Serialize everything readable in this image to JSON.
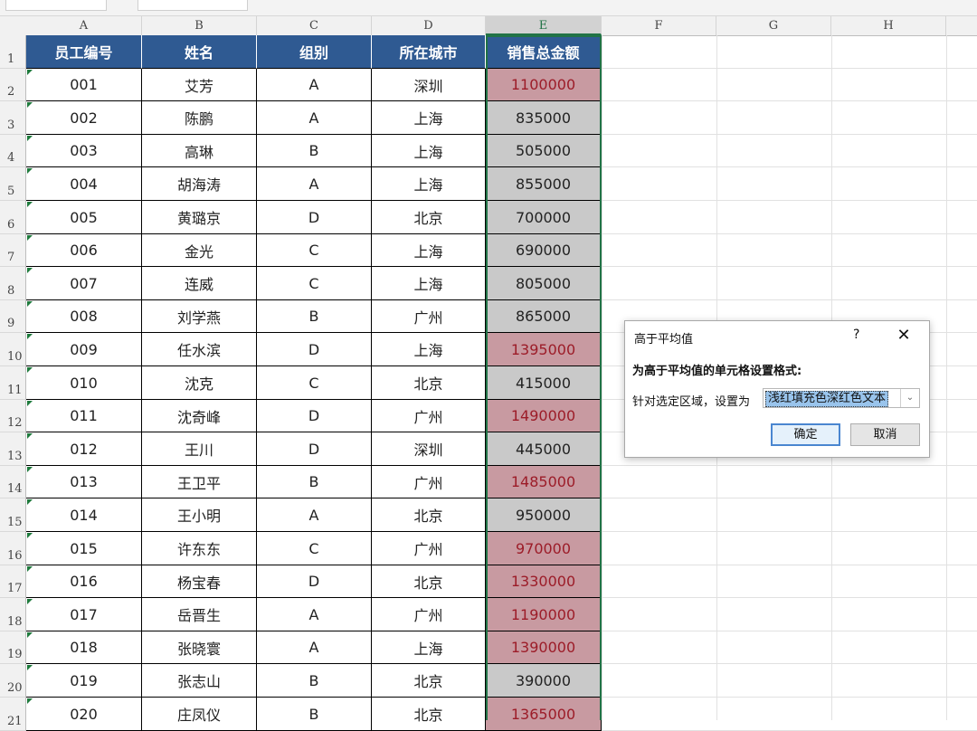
{
  "columns": [
    "A",
    "B",
    "C",
    "D",
    "E",
    "F",
    "G",
    "H"
  ],
  "headers": [
    "员工编号",
    "姓名",
    "组别",
    "所在城市",
    "销售总金额"
  ],
  "rows": [
    {
      "row": "1"
    },
    {
      "row": "2",
      "id": "001",
      "name": "艾芳",
      "group": "A",
      "city": "深圳",
      "sales": "1100000",
      "highlight": true
    },
    {
      "row": "3",
      "id": "002",
      "name": "陈鹏",
      "group": "A",
      "city": "上海",
      "sales": "835000",
      "highlight": false
    },
    {
      "row": "4",
      "id": "003",
      "name": "高琳",
      "group": "B",
      "city": "上海",
      "sales": "505000",
      "highlight": false
    },
    {
      "row": "5",
      "id": "004",
      "name": "胡海涛",
      "group": "A",
      "city": "上海",
      "sales": "855000",
      "highlight": false
    },
    {
      "row": "6",
      "id": "005",
      "name": "黄璐京",
      "group": "D",
      "city": "北京",
      "sales": "700000",
      "highlight": false
    },
    {
      "row": "7",
      "id": "006",
      "name": "金光",
      "group": "C",
      "city": "上海",
      "sales": "690000",
      "highlight": false
    },
    {
      "row": "8",
      "id": "007",
      "name": "连威",
      "group": "C",
      "city": "上海",
      "sales": "805000",
      "highlight": false
    },
    {
      "row": "9",
      "id": "008",
      "name": "刘学燕",
      "group": "B",
      "city": "广州",
      "sales": "865000",
      "highlight": false
    },
    {
      "row": "10",
      "id": "009",
      "name": "任水滨",
      "group": "D",
      "city": "上海",
      "sales": "1395000",
      "highlight": true
    },
    {
      "row": "11",
      "id": "010",
      "name": "沈克",
      "group": "C",
      "city": "北京",
      "sales": "415000",
      "highlight": false
    },
    {
      "row": "12",
      "id": "011",
      "name": "沈奇峰",
      "group": "D",
      "city": "广州",
      "sales": "1490000",
      "highlight": true
    },
    {
      "row": "13",
      "id": "012",
      "name": "王川",
      "group": "D",
      "city": "深圳",
      "sales": "445000",
      "highlight": false
    },
    {
      "row": "14",
      "id": "013",
      "name": "王卫平",
      "group": "B",
      "city": "广州",
      "sales": "1485000",
      "highlight": true
    },
    {
      "row": "15",
      "id": "014",
      "name": "王小明",
      "group": "A",
      "city": "北京",
      "sales": "950000",
      "highlight": false
    },
    {
      "row": "16",
      "id": "015",
      "name": "许东东",
      "group": "C",
      "city": "广州",
      "sales": "970000",
      "highlight": true
    },
    {
      "row": "17",
      "id": "016",
      "name": "杨宝春",
      "group": "D",
      "city": "北京",
      "sales": "1330000",
      "highlight": true
    },
    {
      "row": "18",
      "id": "017",
      "name": "岳晋生",
      "group": "A",
      "city": "广州",
      "sales": "1190000",
      "highlight": true
    },
    {
      "row": "19",
      "id": "018",
      "name": "张晓寰",
      "group": "A",
      "city": "上海",
      "sales": "1390000",
      "highlight": true
    },
    {
      "row": "20",
      "id": "019",
      "name": "张志山",
      "group": "B",
      "city": "北京",
      "sales": "390000",
      "highlight": false
    },
    {
      "row": "21",
      "id": "020",
      "name": "庄凤仪",
      "group": "B",
      "city": "北京",
      "sales": "1365000",
      "highlight": true
    }
  ],
  "dialog": {
    "title": "高于平均值",
    "help": "?",
    "close": "✕",
    "description": "为高于平均值的单元格设置格式:",
    "label": "针对选定区域，设置为",
    "selected_format": "浅红填充色深红色文本",
    "ok": "确定",
    "cancel": "取消"
  },
  "colors": {
    "header_fill": "#2f5a92",
    "highlight_fill": "#c89aa1",
    "highlight_text": "#9c1c28",
    "selection_border": "#217346"
  }
}
